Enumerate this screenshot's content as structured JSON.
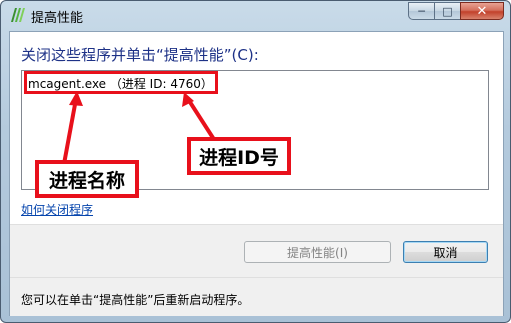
{
  "window": {
    "title": "提高性能",
    "close_glyph": "✕",
    "minimize_glyph": "─",
    "maximize_glyph": "□",
    "icon": "app-logo-icon"
  },
  "dialog": {
    "prompt": "关闭这些程序并单击“提高性能”(C):",
    "process_list": [
      {
        "text": "mcagent.exe （进程 ID: 4760）"
      }
    ],
    "link_label": "如何关闭程序",
    "buttons": {
      "improve_performance": "提高性能(I)",
      "cancel": "取消"
    },
    "footer": "您可以在单击“提高性能”后重新启动程序。"
  },
  "annotations": {
    "process_name_label": "进程名称",
    "process_id_label": "进程ID号"
  },
  "colors": {
    "highlight": "#e8101b",
    "prompt_text": "#1e3287",
    "link": "#0645ad"
  }
}
